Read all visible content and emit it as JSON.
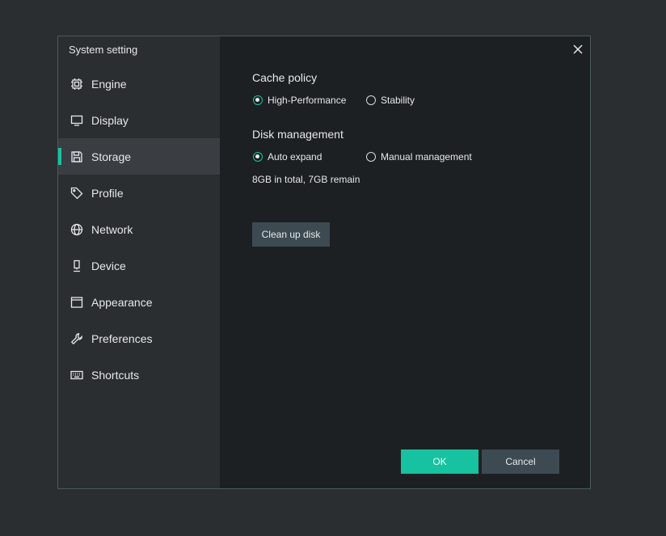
{
  "dialog": {
    "title": "System setting"
  },
  "sidebar": {
    "items": [
      {
        "label": "Engine",
        "icon": "chip-icon"
      },
      {
        "label": "Display",
        "icon": "monitor-icon"
      },
      {
        "label": "Storage",
        "icon": "save-icon",
        "active": true
      },
      {
        "label": "Profile",
        "icon": "tag-icon"
      },
      {
        "label": "Network",
        "icon": "globe-icon"
      },
      {
        "label": "Device",
        "icon": "device-icon"
      },
      {
        "label": "Appearance",
        "icon": "window-icon"
      },
      {
        "label": "Preferences",
        "icon": "wrench-icon"
      },
      {
        "label": "Shortcuts",
        "icon": "keyboard-icon"
      }
    ]
  },
  "storage": {
    "cache_policy": {
      "title": "Cache policy",
      "options": [
        "High-Performance",
        "Stability"
      ],
      "selected": "High-Performance"
    },
    "disk_management": {
      "title": "Disk management",
      "options": [
        "Auto expand",
        "Manual management"
      ],
      "selected": "Auto expand",
      "info": "8GB in total, 7GB remain"
    },
    "clean_button": "Clean up disk"
  },
  "footer": {
    "ok_label": "OK",
    "cancel_label": "Cancel"
  },
  "colors": {
    "accent": "#17c2a0",
    "background": "#2b2e31",
    "panel": "#1d2023"
  }
}
